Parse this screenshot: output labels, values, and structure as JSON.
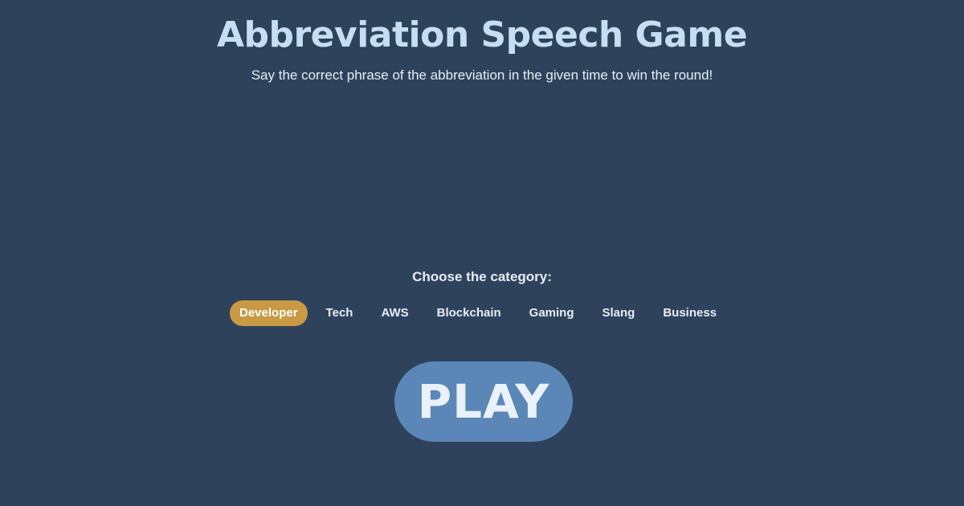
{
  "header": {
    "title": "Abbreviation Speech Game",
    "subtitle": "Say the correct phrase of the abbreviation in the given time to win the round!"
  },
  "categories": {
    "label": "Choose the category:",
    "selected": "Developer",
    "items": [
      {
        "label": "Developer"
      },
      {
        "label": "Tech"
      },
      {
        "label": "AWS"
      },
      {
        "label": "Blockchain"
      },
      {
        "label": "Gaming"
      },
      {
        "label": "Slang"
      },
      {
        "label": "Business"
      }
    ]
  },
  "play": {
    "label": "PLAY"
  },
  "colors": {
    "background": "#2e435b",
    "title": "#c7ddf3",
    "selected_chip": "#c99a43",
    "play_button": "#5a87b7"
  }
}
